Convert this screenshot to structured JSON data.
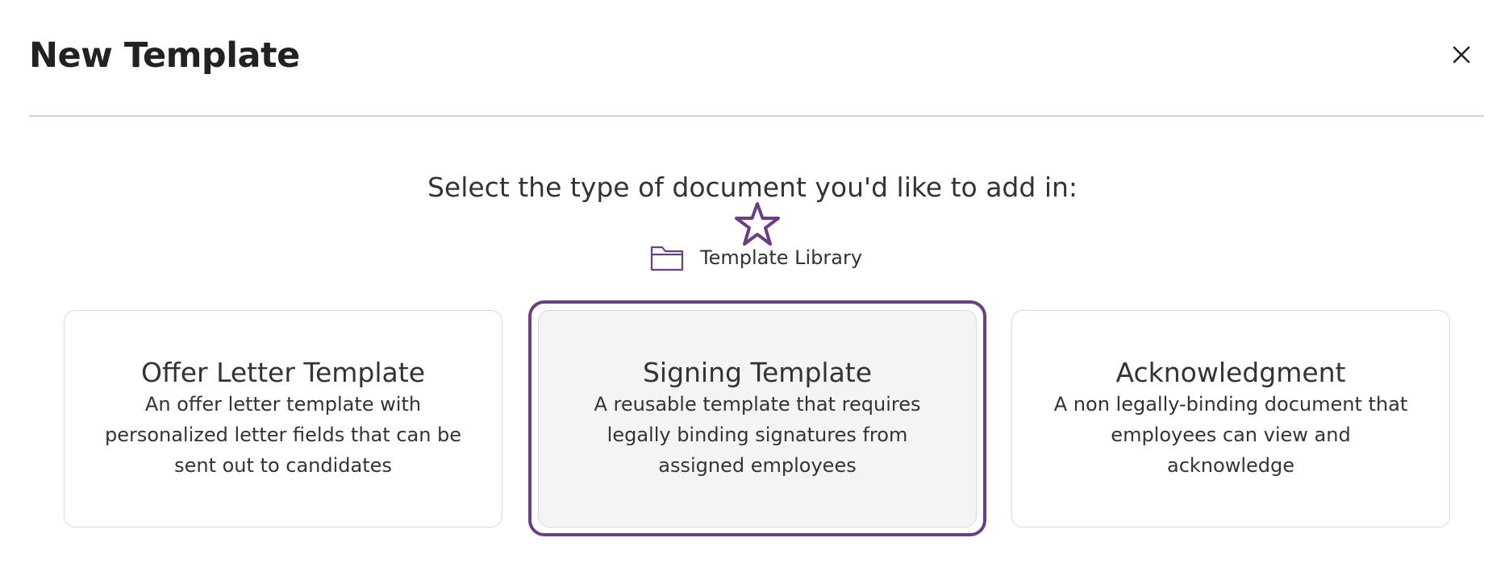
{
  "dialog": {
    "title": "New Template",
    "close_icon": "close-icon"
  },
  "prompt": "Select the type of document you'd like to add in:",
  "template_library": {
    "label": "Template Library",
    "icon": "folder-icon",
    "badge_icon": "star-icon"
  },
  "cards": [
    {
      "title": "Offer Letter Template",
      "description": "An offer letter template with personalized letter fields that can be sent out to candidates",
      "selected": false
    },
    {
      "title": "Signing Template",
      "description": "A reusable template that requires legally binding signatures from assigned employees",
      "selected": true
    },
    {
      "title": "Acknowledgment",
      "description": "A non legally-binding document that employees can view and acknowledge",
      "selected": false
    }
  ],
  "colors": {
    "accent": "#6b3d85",
    "text": "#222222",
    "selected_bg": "#f4f4f6",
    "card_border": "#d8d8de",
    "divider": "#d0d0d0"
  }
}
